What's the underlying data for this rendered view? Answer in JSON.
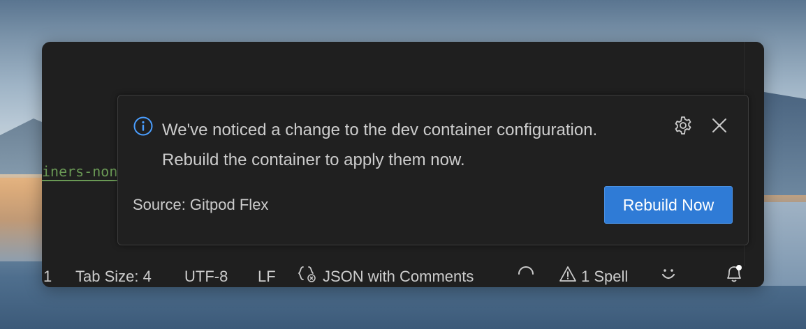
{
  "editor": {
    "code_fragment": "iners-non"
  },
  "notification": {
    "message_line1": "We've noticed a change to the dev container configuration.",
    "message_line2": "Rebuild the container to apply them now.",
    "source": "Source: Gitpod Flex",
    "primary_action": "Rebuild Now",
    "icons": {
      "info": "info-icon",
      "settings": "gear-icon",
      "close": "close-icon"
    },
    "colors": {
      "accent": "#2f7bd6",
      "info": "#4a9eff"
    }
  },
  "status_bar": {
    "line_fragment": "1",
    "tab_size": "Tab Size: 4",
    "encoding": "UTF-8",
    "eol": "LF",
    "language": "JSON with Comments",
    "problems": "1 Spell",
    "icons": [
      "braces-icon",
      "spinner-icon",
      "warning-icon",
      "feedback-icon",
      "bell-icon"
    ]
  }
}
